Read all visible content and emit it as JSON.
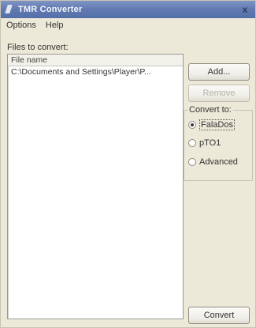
{
  "window": {
    "title": "TMR Converter",
    "close_glyph": "x"
  },
  "menu": {
    "items": [
      {
        "label": "Options"
      },
      {
        "label": "Help"
      }
    ]
  },
  "files_section": {
    "label": "Files to convert:",
    "column_header": "File name",
    "rows": [
      "C:\\Documents and Settings\\Player\\P..."
    ]
  },
  "buttons": {
    "add": "Add...",
    "remove": "Remove",
    "convert": "Convert"
  },
  "convert_to": {
    "title": "Convert to:",
    "options": [
      {
        "label": "FalaDos",
        "checked": true
      },
      {
        "label": "pTO1",
        "checked": false
      },
      {
        "label": "Advanced",
        "checked": false
      }
    ]
  },
  "colors": {
    "titlebar": "#6179b0",
    "window_bg": "#ece9d8",
    "list_bg": "#ffffff"
  },
  "icons": {
    "app": "converter-app-icon",
    "close": "close-icon"
  }
}
